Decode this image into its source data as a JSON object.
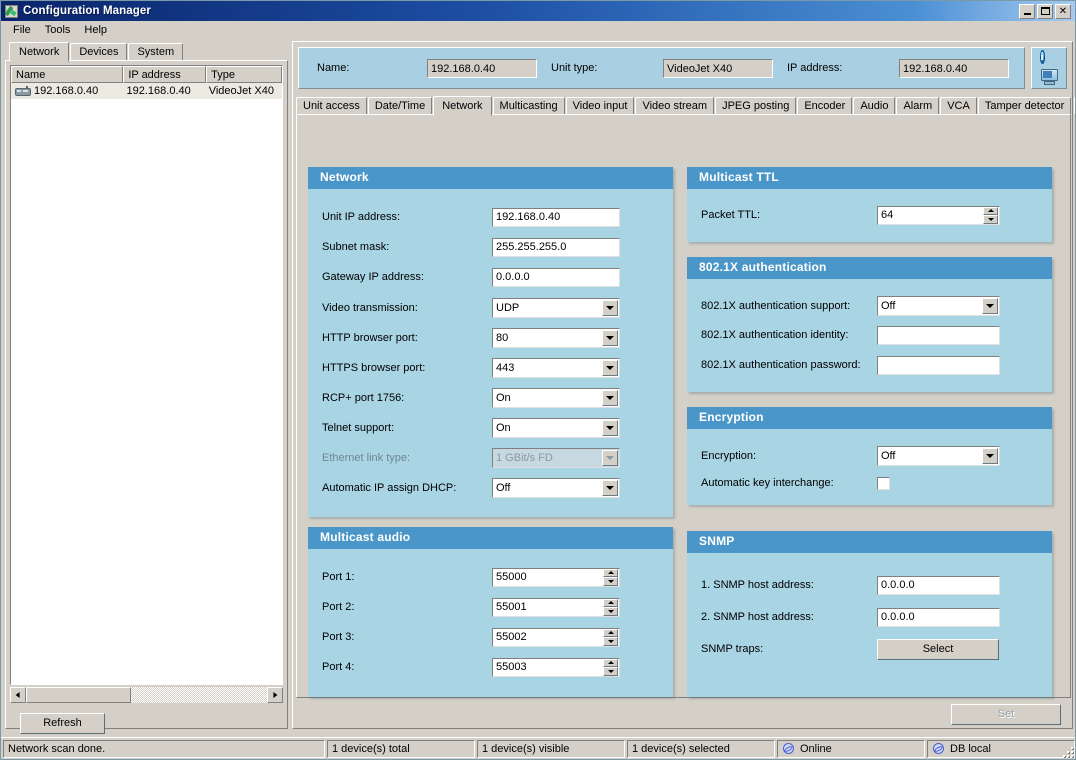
{
  "window": {
    "title": "Configuration Manager",
    "icon": "wrench-icon",
    "minimize": "_",
    "maximize": "□",
    "close": "✕"
  },
  "menu": [
    {
      "label": "File"
    },
    {
      "label": "Tools"
    },
    {
      "label": "Help"
    }
  ],
  "left_pane": {
    "tabs": [
      {
        "label": "Network",
        "active": true
      },
      {
        "label": "Devices",
        "active": false
      },
      {
        "label": "System",
        "active": false
      }
    ],
    "list": {
      "columns": [
        "Name",
        "IP address",
        "Type"
      ],
      "rows": [
        {
          "name": "192.168.0.40",
          "ip": "192.168.0.40",
          "type": "VideoJet X40",
          "icon": "device-icon"
        }
      ]
    },
    "refresh_label": "Refresh"
  },
  "topbar": {
    "name_label": "Name:",
    "name_value": "192.168.0.40",
    "unit_type_label": "Unit type:",
    "unit_type_value": "VideoJet X40",
    "ip_label": "IP address:",
    "ip_value": "192.168.0.40",
    "info_glyph": "i"
  },
  "tabs": [
    {
      "label": "Unit access",
      "active": false
    },
    {
      "label": "Date/Time",
      "active": false
    },
    {
      "label": "Network",
      "active": true
    },
    {
      "label": "Multicasting",
      "active": false
    },
    {
      "label": "Video input",
      "active": false
    },
    {
      "label": "Video stream",
      "active": false
    },
    {
      "label": "JPEG posting",
      "active": false
    },
    {
      "label": "Encoder",
      "active": false
    },
    {
      "label": "Audio",
      "active": false
    },
    {
      "label": "Alarm",
      "active": false
    },
    {
      "label": "VCA",
      "active": false
    },
    {
      "label": "Tamper detector",
      "active": false
    }
  ],
  "groups": {
    "network": {
      "title": "Network",
      "rows": [
        {
          "label": "Unit IP address:",
          "value": "192.168.0.40",
          "type": "text"
        },
        {
          "label": "Subnet mask:",
          "value": "255.255.255.0",
          "type": "text"
        },
        {
          "label": "Gateway IP address:",
          "value": "0.0.0.0",
          "type": "text"
        },
        {
          "label": "Video transmission:",
          "value": "UDP",
          "type": "combo"
        },
        {
          "label": "HTTP browser port:",
          "value": "80",
          "type": "combo"
        },
        {
          "label": "HTTPS browser port:",
          "value": "443",
          "type": "combo"
        },
        {
          "label": "RCP+ port 1756:",
          "value": "On",
          "type": "combo"
        },
        {
          "label": "Telnet support:",
          "value": "On",
          "type": "combo"
        },
        {
          "label": "Ethernet link type:",
          "value": "1 GBit/s FD",
          "type": "combo",
          "disabled": true
        },
        {
          "label": "Automatic IP assign DHCP:",
          "value": "Off",
          "type": "combo"
        }
      ]
    },
    "multicast_audio": {
      "title": "Multicast audio",
      "rows": [
        {
          "label": "Port 1:",
          "value": "55000",
          "type": "spin"
        },
        {
          "label": "Port 2:",
          "value": "55001",
          "type": "spin"
        },
        {
          "label": "Port 3:",
          "value": "55002",
          "type": "spin"
        },
        {
          "label": "Port 4:",
          "value": "55003",
          "type": "spin"
        }
      ]
    },
    "multicast_ttl": {
      "title": "Multicast TTL",
      "rows": [
        {
          "label": "Packet TTL:",
          "value": "64",
          "type": "spin"
        }
      ]
    },
    "auth8021x": {
      "title": "802.1X authentication",
      "rows": [
        {
          "label": "802.1X authentication support:",
          "value": "Off",
          "type": "combo"
        },
        {
          "label": "802.1X authentication identity:",
          "value": "",
          "type": "text"
        },
        {
          "label": "802.1X authentication password:",
          "value": "",
          "type": "text"
        }
      ]
    },
    "encryption": {
      "title": "Encryption",
      "rows": [
        {
          "label": "Encryption:",
          "value": "Off",
          "type": "combo"
        },
        {
          "label": "Automatic key interchange:",
          "value": "",
          "type": "checkbox",
          "checked": false
        }
      ]
    },
    "snmp": {
      "title": "SNMP",
      "rows": [
        {
          "label": "1. SNMP host address:",
          "value": "0.0.0.0",
          "type": "text"
        },
        {
          "label": "2. SNMP host address:",
          "value": "0.0.0.0",
          "type": "text"
        },
        {
          "label": "SNMP traps:",
          "value": "Select",
          "type": "button"
        }
      ]
    }
  },
  "set_button": {
    "label": "Set",
    "disabled": true
  },
  "statusbar": {
    "message": "Network scan done.",
    "total": "1 device(s) total",
    "visible": "1 device(s) visible",
    "selected": "1 device(s) selected",
    "online": "Online",
    "db": "DB local"
  },
  "colors": {
    "group_header": "#4b96c8",
    "group_body": "#a9d4e4",
    "titlebar": "#0a246a",
    "chrome": "#d4d0c8"
  }
}
